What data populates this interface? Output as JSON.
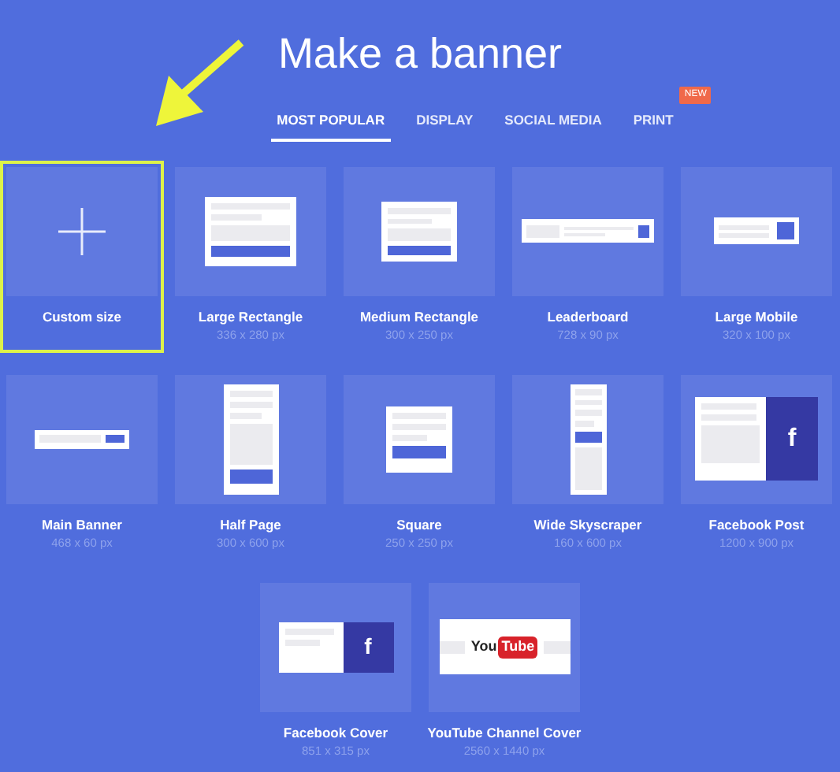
{
  "title": "Make a banner",
  "tabs": [
    {
      "label": "MOST POPULAR",
      "selected": true
    },
    {
      "label": "DISPLAY",
      "selected": false
    },
    {
      "label": "SOCIAL MEDIA",
      "selected": false
    },
    {
      "label": "PRINT",
      "selected": false,
      "badge": "NEW"
    }
  ],
  "rows": [
    [
      {
        "kind": "custom",
        "name": "Custom size",
        "selected": true
      },
      {
        "kind": "large-rect",
        "name": "Large Rectangle",
        "size": "336 x 280 px",
        "selected": false
      },
      {
        "kind": "medium-rect",
        "name": "Medium Rectangle",
        "size": "300 x 250 px",
        "selected": false
      },
      {
        "kind": "leaderboard",
        "name": "Leaderboard",
        "size": "728 x 90 px",
        "selected": false
      },
      {
        "kind": "large-mobile",
        "name": "Large Mobile",
        "size": "320 x 100 px",
        "selected": false
      }
    ],
    [
      {
        "kind": "main-banner",
        "name": "Main Banner",
        "size": "468 x 60 px",
        "selected": false
      },
      {
        "kind": "half-page",
        "name": "Half Page",
        "size": "300 x 600 px",
        "selected": false
      },
      {
        "kind": "square",
        "name": "Square",
        "size": "250 x 250 px",
        "selected": false
      },
      {
        "kind": "skyscraper",
        "name": "Wide Skyscraper",
        "size": "160 x 600 px",
        "selected": false
      },
      {
        "kind": "fb-post",
        "name": "Facebook Post",
        "size": "1200 x 900 px",
        "selected": false,
        "glyph": "f"
      }
    ],
    [
      {
        "kind": "fb-cover",
        "name": "Facebook Cover",
        "size": "851 x 315 px",
        "selected": false,
        "glyph": "f"
      },
      {
        "kind": "yt-cover",
        "name": "YouTube Channel Cover",
        "size": "2560 x 1440 px",
        "selected": false,
        "logo": [
          "You",
          "Tube"
        ]
      }
    ]
  ]
}
